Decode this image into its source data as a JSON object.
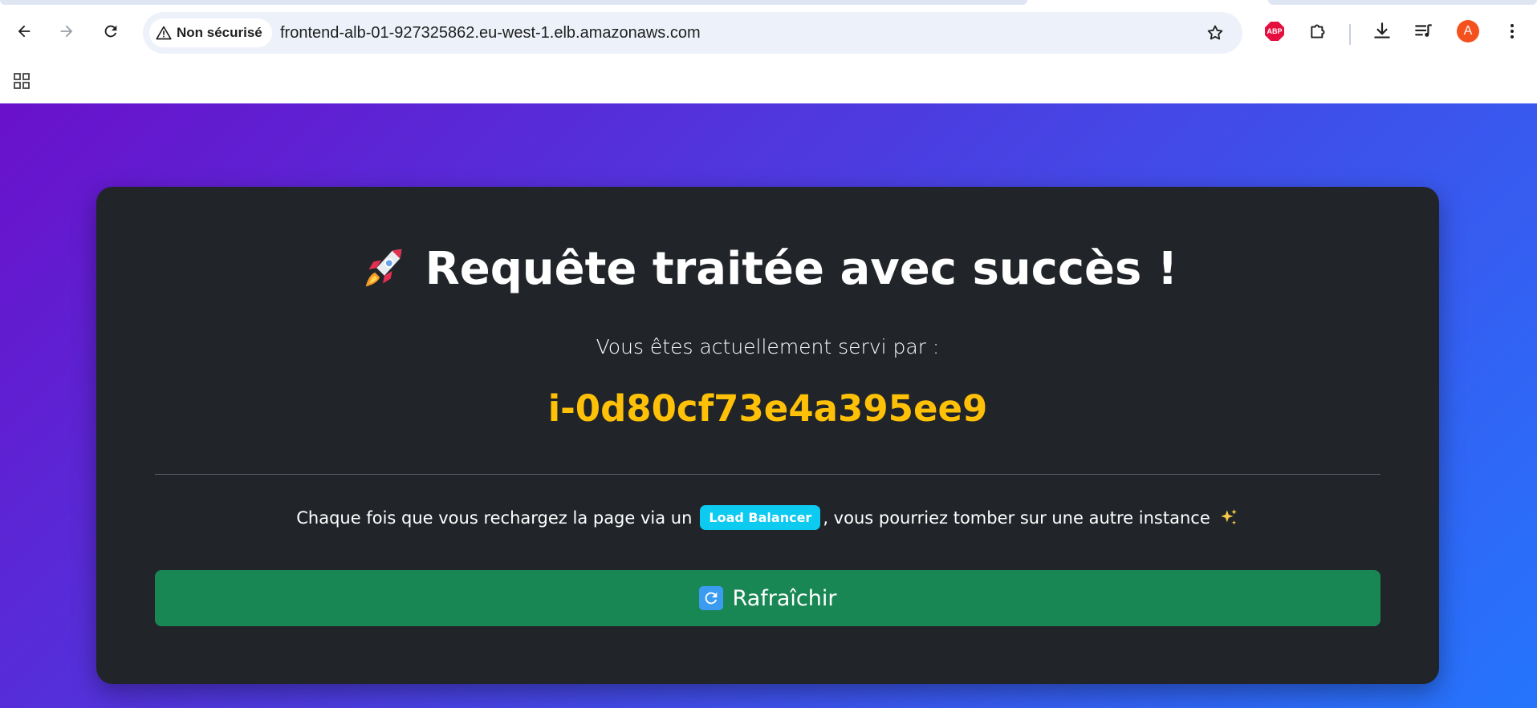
{
  "browser": {
    "security_label": "Non sécurisé",
    "url": "frontend-alb-01-927325862.eu-west-1.elb.amazonaws.com",
    "abp_label": "ABP",
    "profile_initial": "A"
  },
  "page": {
    "heading": "Requête traitée avec succès !",
    "subtitle": "Vous êtes actuellement servi par :",
    "instance_id": "i-0d80cf73e4a395ee9",
    "info_before": "Chaque fois que vous rechargez la page via un",
    "badge": "Load Balancer",
    "info_after": ", vous pourriez tomber sur une autre instance",
    "refresh_label": "Rafraîchir"
  },
  "colors": {
    "gradient_start": "#6a11cb",
    "gradient_end": "#2575fc",
    "card": "#212529",
    "instance_id": "#ffc107",
    "badge": "#0dcaf0",
    "button": "#198754"
  },
  "icons": {
    "heading": "rocket-icon",
    "info": "sparkles-icon",
    "button": "refresh-icon"
  }
}
